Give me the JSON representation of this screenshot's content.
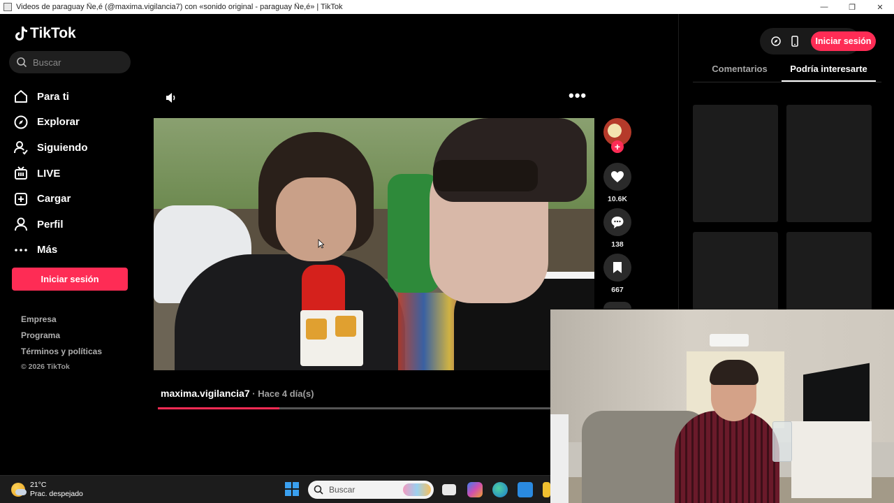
{
  "window": {
    "title": "Videos de paraguay Ñe,é (@maxima.vigilancia7) con «sonido original - paraguay Ñe,é» | TikTok",
    "minimize": "—",
    "maximize": "❐",
    "close": "✕"
  },
  "sidebar": {
    "logo_text": "TikTok",
    "search_placeholder": "Buscar",
    "nav": [
      {
        "label": "Para ti",
        "icon": "home-icon"
      },
      {
        "label": "Explorar",
        "icon": "compass-icon"
      },
      {
        "label": "Siguiendo",
        "icon": "following-icon"
      },
      {
        "label": "LIVE",
        "icon": "live-icon"
      },
      {
        "label": "Cargar",
        "icon": "upload-icon"
      },
      {
        "label": "Perfil",
        "icon": "profile-icon"
      },
      {
        "label": "Más",
        "icon": "more-icon"
      }
    ],
    "login_label": "Iniciar sesión",
    "footer": {
      "empresa": "Empresa",
      "programa": "Programa",
      "terminos": "Términos y políticas",
      "copyright": "© 2026 TikTok"
    }
  },
  "video": {
    "more_label": "•••",
    "author": "maxima.vigilancia7",
    "time": " · Hace 4 día(s)",
    "progress_fraction": 0.31,
    "likes": "10.6K",
    "comments": "138",
    "saves": "667",
    "follow_symbol": "+"
  },
  "right_panel": {
    "login_label": "Iniciar sesión",
    "tabs": [
      "Comentarios",
      "Podría interesarte"
    ],
    "active_tab": "Podría interesarte"
  },
  "taskbar": {
    "temperature": "21°C",
    "weather": "Prac. despejado",
    "search_placeholder": "Buscar"
  },
  "colors": {
    "accent": "#fe2c55",
    "background": "#000000"
  }
}
